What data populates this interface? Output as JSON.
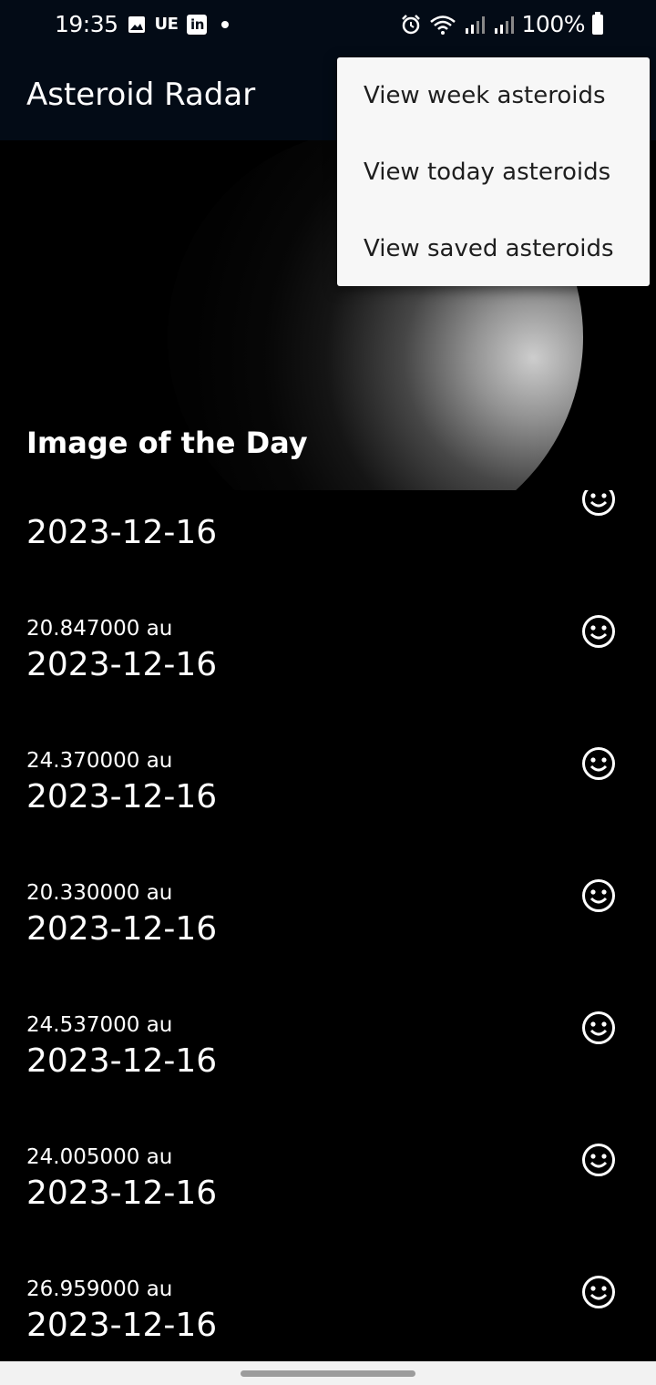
{
  "status_bar": {
    "time": "19:35",
    "carrier_badge": "UE",
    "linkedin_badge": "in",
    "battery": "100%",
    "icons": [
      "image-icon",
      "linkedin-icon",
      "alarm-icon",
      "wifi-icon",
      "signal-icon",
      "battery-icon"
    ]
  },
  "app_bar": {
    "title": "Asteroid Radar"
  },
  "image_of_day": {
    "label": "Image of the Day"
  },
  "menu": {
    "items": [
      {
        "label": "View week asteroids"
      },
      {
        "label": "View today asteroids"
      },
      {
        "label": "View saved asteroids"
      }
    ]
  },
  "asteroids": [
    {
      "distance": "",
      "date": "2023-12-16",
      "icon": "smiley-icon"
    },
    {
      "distance": "20.847000 au",
      "date": "2023-12-16",
      "icon": "smiley-icon"
    },
    {
      "distance": "24.370000 au",
      "date": "2023-12-16",
      "icon": "smiley-icon"
    },
    {
      "distance": "20.330000 au",
      "date": "2023-12-16",
      "icon": "smiley-icon"
    },
    {
      "distance": "24.537000 au",
      "date": "2023-12-16",
      "icon": "smiley-icon"
    },
    {
      "distance": "24.005000 au",
      "date": "2023-12-16",
      "icon": "smiley-icon"
    },
    {
      "distance": "26.959000 au",
      "date": "2023-12-16",
      "icon": "smiley-icon"
    }
  ],
  "colors": {
    "app_bar_bg": "#030b16",
    "background": "#000000",
    "menu_bg": "#f7f7f7",
    "text": "#ffffff"
  }
}
